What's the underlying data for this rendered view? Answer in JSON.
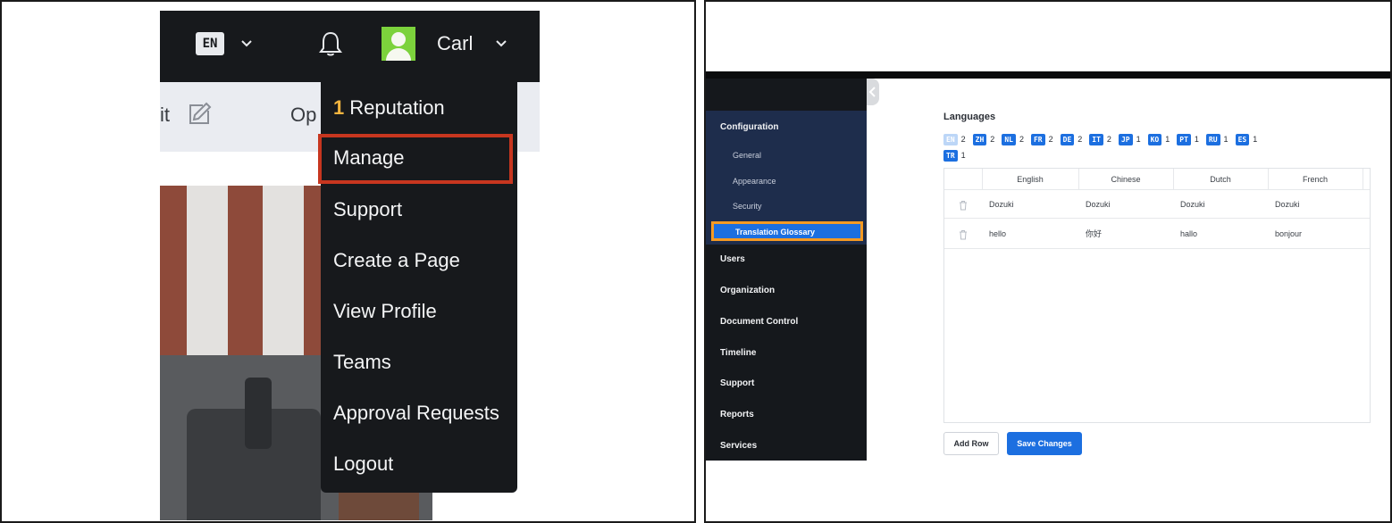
{
  "left_panel": {
    "topbar": {
      "language": "EN",
      "user_name": "Carl",
      "icons": [
        "chevron-down-icon",
        "bell-icon",
        "avatar",
        "chevron-down-icon"
      ]
    },
    "toolbar": {
      "edit_fragment": "it",
      "options_fragment": "Op"
    },
    "dropdown": {
      "reputation_count": "1",
      "reputation_label": "Reputation",
      "items": [
        "Manage",
        "Support",
        "Create a Page",
        "View Profile",
        "Teams",
        "Approval Requests",
        "Logout"
      ],
      "highlighted_item": "Manage",
      "highlight_color": "#c7361f"
    }
  },
  "right_panel": {
    "sidebar": {
      "sections": [
        "Configuration",
        "Users",
        "Organization",
        "Document Control",
        "Timeline",
        "Support",
        "Reports",
        "Services"
      ],
      "configuration_items": [
        "General",
        "Appearance",
        "Security",
        "Translation Glossary"
      ],
      "active_item": "Translation Glossary",
      "active_color": "#1c6fe0",
      "highlight_color": "#f59a23"
    },
    "languages": {
      "title": "Languages",
      "pills": [
        {
          "code": "EN",
          "count": "2"
        },
        {
          "code": "ZH",
          "count": "2"
        },
        {
          "code": "NL",
          "count": "2"
        },
        {
          "code": "FR",
          "count": "2"
        },
        {
          "code": "DE",
          "count": "2"
        },
        {
          "code": "IT",
          "count": "2"
        },
        {
          "code": "JP",
          "count": "1"
        },
        {
          "code": "KO",
          "count": "1"
        },
        {
          "code": "PT",
          "count": "1"
        },
        {
          "code": "RU",
          "count": "1"
        },
        {
          "code": "ES",
          "count": "1"
        },
        {
          "code": "TR",
          "count": "1"
        }
      ]
    },
    "glossary": {
      "columns": [
        "English",
        "Chinese",
        "Dutch",
        "French"
      ],
      "rows": [
        [
          "Dozuki",
          "Dozuki",
          "Dozuki",
          "Dozuki"
        ],
        [
          "hello",
          "你好",
          "hallo",
          "bonjour"
        ]
      ]
    },
    "buttons": {
      "add_row": "Add Row",
      "save_changes": "Save Changes"
    }
  }
}
